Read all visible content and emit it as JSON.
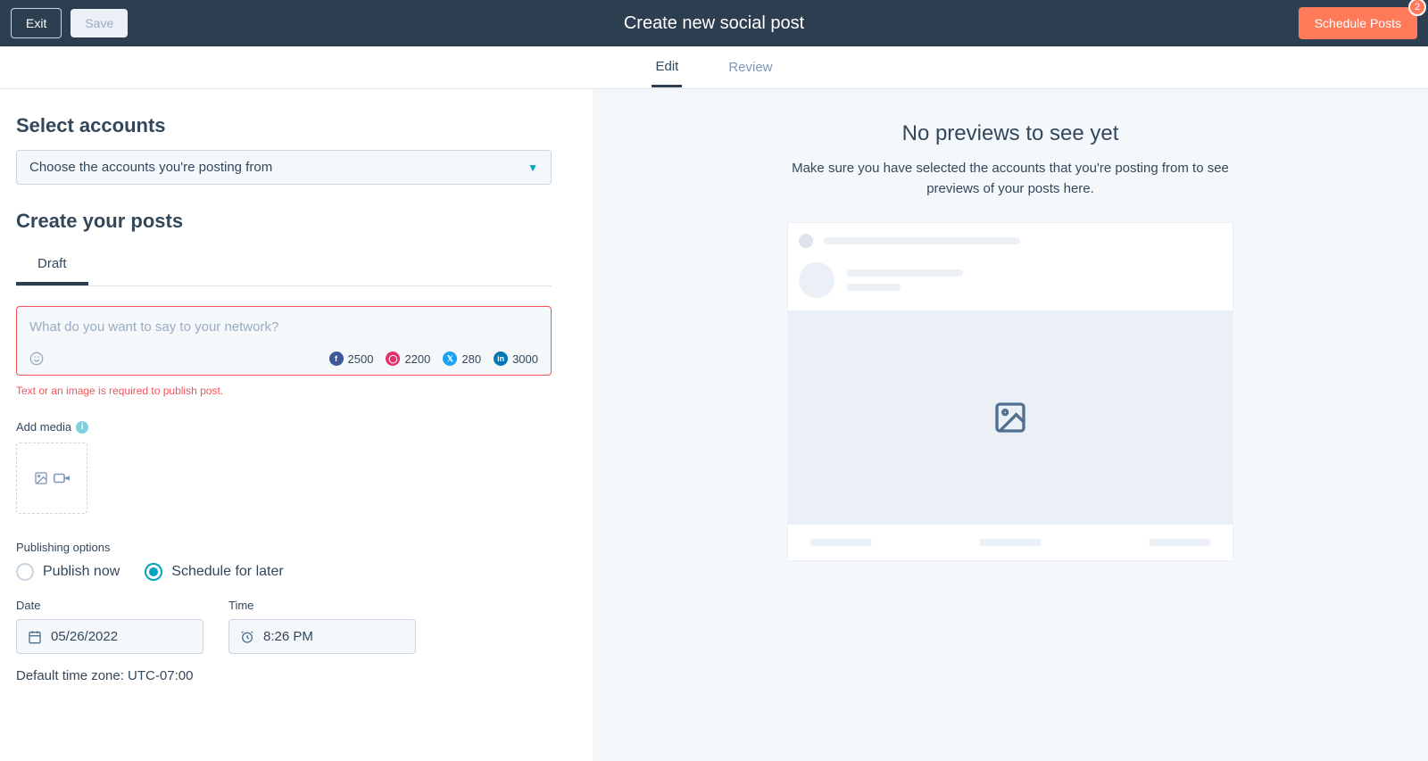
{
  "top": {
    "exit": "Exit",
    "save": "Save",
    "title": "Create new social post",
    "schedule": "Schedule Posts",
    "badge": "2"
  },
  "tabs": {
    "edit": "Edit",
    "review": "Review"
  },
  "left": {
    "select_accounts": "Select accounts",
    "choose_placeholder": "Choose the accounts you're posting from",
    "create_posts": "Create your posts",
    "draft_tab": "Draft",
    "composer_placeholder": "What do you want to say to your network?",
    "counters": {
      "fb": "2500",
      "ig": "2200",
      "tw": "280",
      "li": "3000"
    },
    "error": "Text or an image is required to publish post.",
    "add_media": "Add media",
    "pub_options": "Publishing options",
    "publish_now": "Publish now",
    "schedule_later": "Schedule for later",
    "date_label": "Date",
    "date_value": "05/26/2022",
    "time_label": "Time",
    "time_value": "8:26 PM",
    "tz": "Default time zone: UTC-07:00"
  },
  "right": {
    "title": "No previews to see yet",
    "desc": "Make sure you have selected the accounts that you're posting from to see previews of your posts here."
  }
}
